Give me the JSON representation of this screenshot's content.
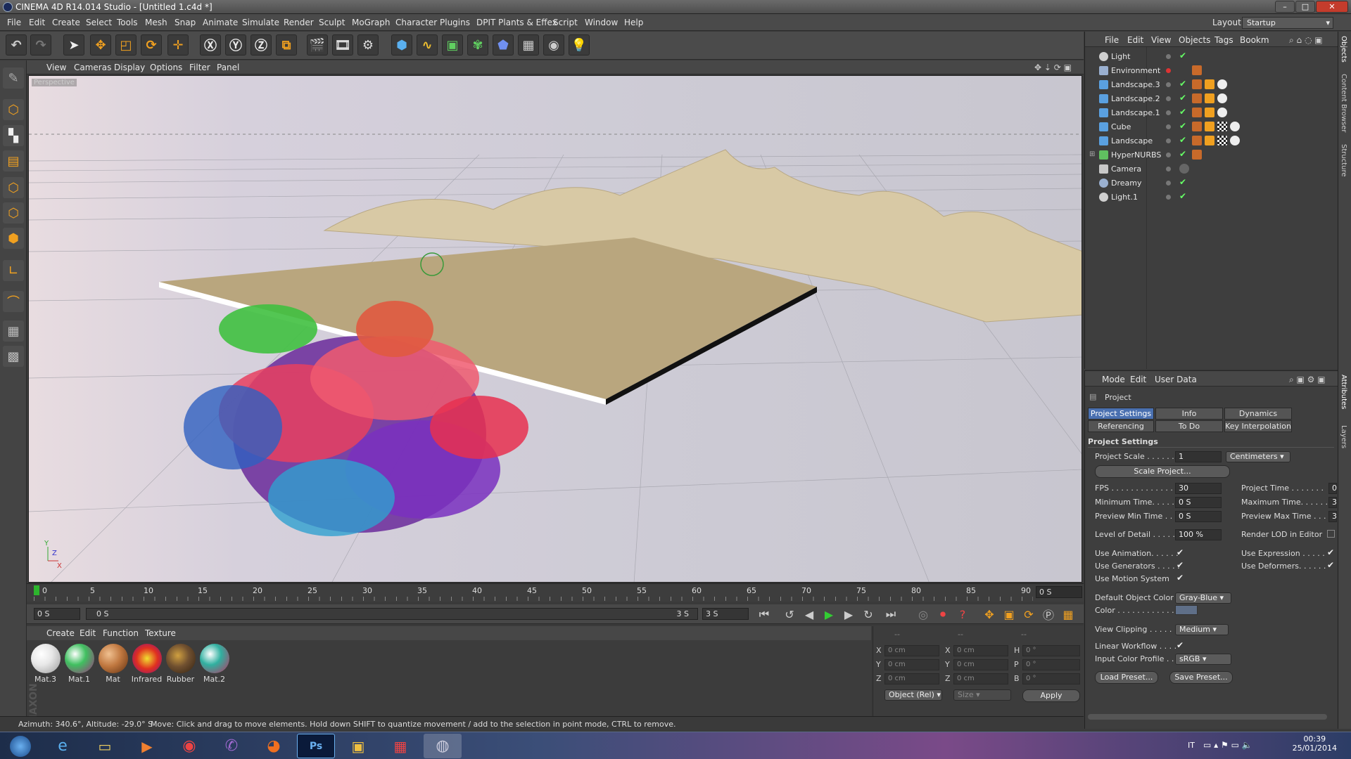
{
  "window": {
    "title": "CINEMA 4D R14.014 Studio - [Untitled 1.c4d *]"
  },
  "menu": [
    "File",
    "Edit",
    "Create",
    "Select",
    "Tools",
    "Mesh",
    "Snap",
    "Animate",
    "Simulate",
    "Render",
    "Sculpt",
    "MoGraph",
    "Character",
    "Plugins",
    "DPIT Plants & Effex",
    "Script",
    "Window",
    "Help"
  ],
  "layout": {
    "label": "Layout:",
    "value": "Startup"
  },
  "viewport_menu": [
    "View",
    "Cameras",
    "Display",
    "Options",
    "Filter",
    "Panel"
  ],
  "viewport": {
    "label": "Perspective"
  },
  "timeline": {
    "ticks": [
      "0",
      "5",
      "10",
      "15",
      "20",
      "25",
      "30",
      "35",
      "40",
      "45",
      "50",
      "55",
      "60",
      "65",
      "70",
      "75",
      "80",
      "85",
      "90"
    ],
    "current": "0 S",
    "start": "0 S",
    "range_start": "0 S",
    "range_end": "3 S",
    "end": "3 S"
  },
  "material_menu": [
    "Create",
    "Edit",
    "Function",
    "Texture"
  ],
  "materials": [
    {
      "name": "Mat.3",
      "color": "#e8e8e8"
    },
    {
      "name": "Mat.1",
      "color": "#40c060"
    },
    {
      "name": "Mat",
      "color": "#c07840"
    },
    {
      "name": "Infrared",
      "color": "#e03020"
    },
    {
      "name": "Rubber",
      "color": "#705030"
    },
    {
      "name": "Mat.2",
      "color": "#30b0a0"
    }
  ],
  "coordinates": {
    "header": [
      "--",
      "--",
      "--"
    ],
    "rows": [
      {
        "axis": "X",
        "pos": "0 cm",
        "axis2": "X",
        "size": "0 cm",
        "axis3": "H",
        "rot": "0 °"
      },
      {
        "axis": "Y",
        "pos": "0 cm",
        "axis2": "Y",
        "size": "0 cm",
        "axis3": "P",
        "rot": "0 °"
      },
      {
        "axis": "Z",
        "pos": "0 cm",
        "axis2": "Z",
        "size": "0 cm",
        "axis3": "B",
        "rot": "0 °"
      }
    ],
    "mode": "Object (Rel)",
    "size_mode": "Size",
    "apply": "Apply"
  },
  "status": {
    "left": "Azimuth: 340.6°, Altitude: -29.0°  S",
    "message": "Move: Click and drag to move elements. Hold down SHIFT to quantize movement / add to the selection in point mode, CTRL to remove."
  },
  "object_menu": [
    "File",
    "Edit",
    "View",
    "Objects",
    "Tags",
    "Bookm"
  ],
  "objects": [
    {
      "name": "Light",
      "icon": "light-icon",
      "color": "#c8c8c8",
      "check": "✔"
    },
    {
      "name": "Environment",
      "icon": "environment-icon",
      "color": "#9ab0d0",
      "check": ""
    },
    {
      "name": "Landscape.3",
      "icon": "landscape-icon",
      "color": "#5aa0e0",
      "check": "✔"
    },
    {
      "name": "Landscape.2",
      "icon": "landscape-icon",
      "color": "#5aa0e0",
      "check": "✔"
    },
    {
      "name": "Landscape.1",
      "icon": "landscape-icon",
      "color": "#5aa0e0",
      "check": "✔"
    },
    {
      "name": "Cube",
      "icon": "cube-icon",
      "color": "#5aa0e0",
      "check": "✔"
    },
    {
      "name": "Landscape",
      "icon": "landscape-icon",
      "color": "#5aa0e0",
      "check": "✔"
    },
    {
      "name": "HyperNURBS",
      "icon": "hypernurbs-icon",
      "color": "#60c060",
      "check": "✔"
    },
    {
      "name": "Camera",
      "icon": "camera-icon",
      "color": "#c8c8c8",
      "check": ""
    },
    {
      "name": "Dreamy",
      "icon": "sky-icon",
      "color": "#9ab0d0",
      "check": "✔"
    },
    {
      "name": "Light.1",
      "icon": "light-icon",
      "color": "#c8c8c8",
      "check": "✔"
    }
  ],
  "attr_menu": [
    "Mode",
    "Edit",
    "User Data"
  ],
  "attributes": {
    "heading": "Project",
    "tabs_row1": [
      "Project Settings",
      "Info",
      "Dynamics"
    ],
    "tabs_row2": [
      "Referencing",
      "To Do",
      "Key Interpolation"
    ],
    "section": "Project Settings",
    "project_scale_label": "Project Scale . . . . . .",
    "project_scale": "1",
    "scale_unit": "Centimeters",
    "scale_button": "Scale Project...",
    "fps_label": "FPS . . . . . . . . . . . . . .",
    "fps": "30",
    "project_time_label": "Project Time . . . . . . .",
    "project_time": "0",
    "min_time_label": "Minimum Time. . . . . .",
    "min_time": "0 S",
    "max_time_label": "Maximum Time. . . . . .",
    "max_time": "3",
    "prev_min_label": "Preview Min Time . . .",
    "prev_min": "0 S",
    "prev_max_label": "Preview Max Time . . .",
    "prev_max": "3",
    "lod_label": "Level of Detail . . . . .",
    "lod": "100 %",
    "render_lod_label": "Render LOD in Editor",
    "use_anim_label": "Use Animation. . . . . .",
    "use_expr_label": "Use Expression . . . . .",
    "use_gen_label": "Use Generators . . . . .",
    "use_def_label": "Use Deformers. . . . . .",
    "use_motion_label": "Use Motion System",
    "def_color_label": "Default Object Color",
    "def_color": "Gray-Blue",
    "color_label": "Color . . . . . . . . . . . .",
    "clipping_label": "View Clipping . . . . . .",
    "clipping": "Medium",
    "linear_label": "Linear Workflow . . . .",
    "profile_label": "Input Color Profile . . .",
    "profile": "sRGB",
    "load_preset": "Load Preset...",
    "save_preset": "Save Preset...",
    "check": "✔"
  },
  "side_tabs": [
    "Objects",
    "Content Browser",
    "Structure",
    "Attributes",
    "Layers"
  ],
  "taskbar": {
    "lang": "IT",
    "time": "00:39",
    "date": "25/01/2014"
  }
}
